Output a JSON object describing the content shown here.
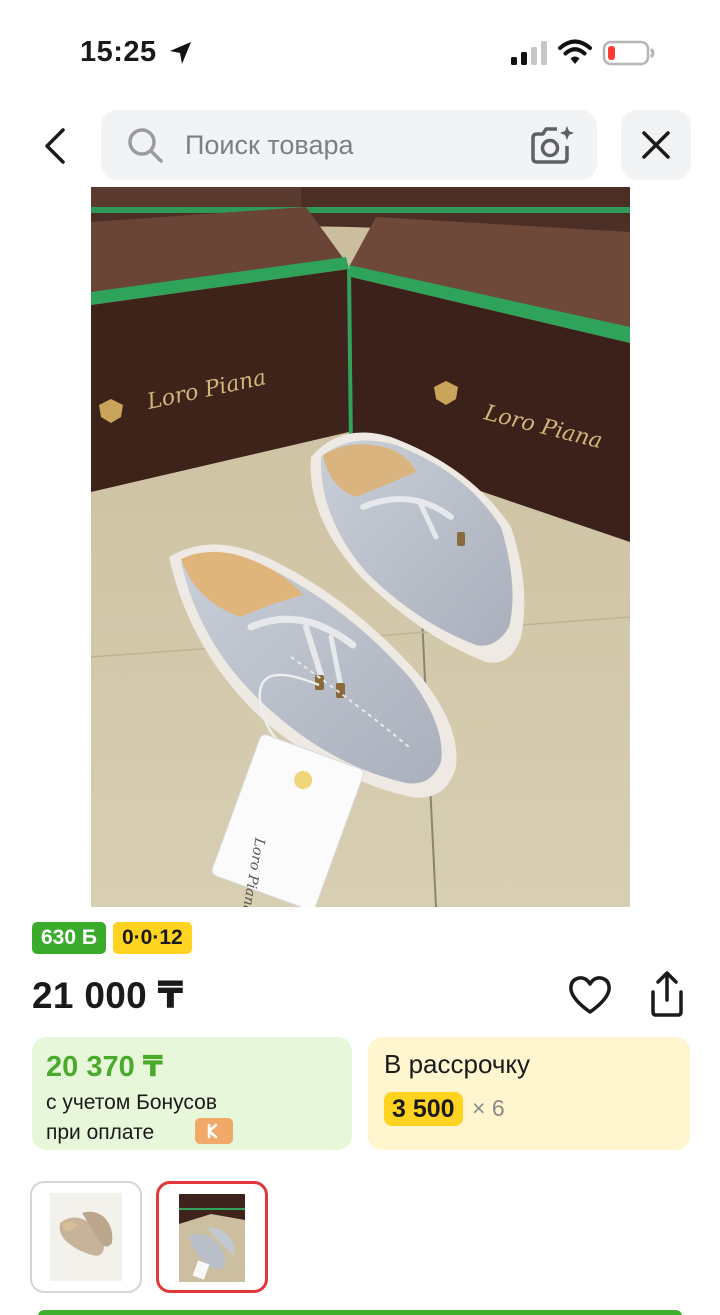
{
  "status_bar": {
    "time": "15:25",
    "icons": [
      "location-arrow-icon",
      "signal-icon",
      "wifi-icon",
      "battery-low-icon"
    ]
  },
  "search": {
    "placeholder": "Поиск товара",
    "back_icon": "chevron-left-icon",
    "camera_icon": "camera-sparkle-icon",
    "close_icon": "close-icon"
  },
  "product": {
    "photo_icon": "product-photo",
    "brand_on_box": "Loro Piana",
    "bonus_badge": "630 Б",
    "installment_badge": "0·0·12",
    "price": "21 000 ₸",
    "favorite_icon": "heart-icon",
    "share_icon": "share-icon"
  },
  "bonus_card": {
    "amount": "20 370 ₸",
    "line1": "с учетом Бонусов",
    "line2": "при оплате"
  },
  "installment_card": {
    "title": "В рассрочку",
    "amount": "3 500",
    "multiplier": "× 6"
  },
  "thumbnails": [
    {
      "name": "thumbnail-beige-loafer",
      "selected": false
    },
    {
      "name": "thumbnail-grey-loafer",
      "selected": true
    }
  ],
  "colors": {
    "accent_green": "#3bab2d",
    "accent_yellow": "#ffd31f",
    "selected_red": "#e0373a",
    "bonus_card_bg": "#e6f8d9",
    "installment_card_bg": "#fff6cf"
  }
}
